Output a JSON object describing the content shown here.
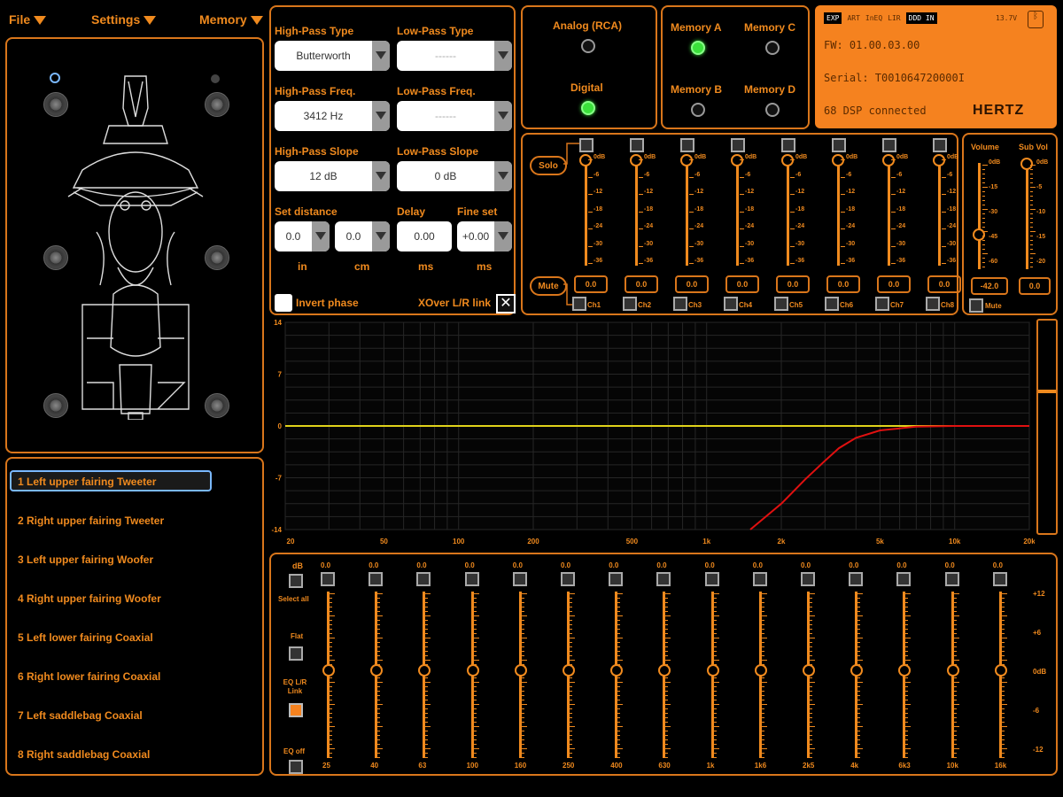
{
  "menu": {
    "file": "File",
    "settings": "Settings",
    "memory": "Memory"
  },
  "channels": [
    "1  Left upper fairing Tweeter",
    "2  Right upper fairing Tweeter",
    "3  Left upper fairing Woofer",
    "4  Right upper fairing Woofer",
    "5  Left lower fairing Coaxial",
    "6  Right lower fairing Coaxial",
    "7  Left saddlebag Coaxial",
    "8  Right saddlebag Coaxial"
  ],
  "selected_channel_index": 0,
  "crossover": {
    "hp_type_label": "High-Pass Type",
    "hp_type_value": "Butterworth",
    "lp_type_label": "Low-Pass Type",
    "lp_type_value": "------",
    "hp_freq_label": "High-Pass Freq.",
    "hp_freq_value": "3412 Hz",
    "lp_freq_label": "Low-Pass Freq.",
    "lp_freq_value": "------",
    "hp_slope_label": "High-Pass Slope",
    "hp_slope_value": "12 dB",
    "lp_slope_label": "Low-Pass Slope",
    "lp_slope_value": "0 dB",
    "set_distance_label": "Set distance",
    "distance_in": "0.0",
    "distance_cm": "0.0",
    "delay_label": "Delay",
    "delay_value": "0.00",
    "fine_set_label": "Fine set",
    "fine_set_value": "+0.00",
    "unit_in": "in",
    "unit_cm": "cm",
    "unit_ms1": "ms",
    "unit_ms2": "ms",
    "invert_phase_label": "Invert phase",
    "xover_link_label": "XOver L/R link"
  },
  "input": {
    "analog": "Analog (RCA)",
    "digital": "Digital",
    "active": "digital"
  },
  "memory": {
    "a": "Memory A",
    "b": "Memory B",
    "c": "Memory C",
    "d": "Memory D",
    "active": "a"
  },
  "device": {
    "tags": [
      "EXP",
      "ART",
      "InEQ",
      "LIR",
      "DDD IN"
    ],
    "voltage": "13.7V",
    "fw": "FW: 01.00.03.00",
    "serial": "Serial: T001064720000I",
    "status": "68 DSP connected",
    "brand": "HERTZ",
    "accent": "#f5821f"
  },
  "mixer": {
    "solo": "Solo",
    "mute": "Mute",
    "channel_labels": [
      "Ch1",
      "Ch2",
      "Ch3",
      "Ch4",
      "Ch5",
      "Ch6",
      "Ch7",
      "Ch8"
    ],
    "values": [
      "0.0",
      "0.0",
      "0.0",
      "0.0",
      "0.0",
      "0.0",
      "0.0",
      "0.0"
    ],
    "scale": [
      "0dB",
      "-6",
      "-12",
      "-18",
      "-24",
      "-30",
      "-36"
    ]
  },
  "master": {
    "volume_label": "Volume",
    "subvol_label": "Sub Vol",
    "volume_value": "-42.0",
    "subvol_value": "0.0",
    "volume_scale": [
      "0dB",
      "-15",
      "-30",
      "-45",
      "-60"
    ],
    "subvol_scale": [
      "0dB",
      "-5",
      "-10",
      "-15",
      "-20"
    ],
    "mute_label": "Mute"
  },
  "chart_data": {
    "type": "line",
    "title": "",
    "y_ticks": [
      "14",
      "7",
      "0",
      "-7",
      "-14"
    ],
    "ylim": [
      -14,
      14
    ],
    "x_ticks": [
      "20",
      "50",
      "100",
      "200",
      "500",
      "1k",
      "2k",
      "5k",
      "10k",
      "20k"
    ],
    "x_tick_values": [
      20,
      50,
      100,
      200,
      500,
      1000,
      2000,
      5000,
      10000,
      20000
    ],
    "series": [
      {
        "color": "#e0d21a",
        "x": [
          20,
          20000
        ],
        "y": [
          0,
          0
        ]
      },
      {
        "color": "#e01010",
        "x": [
          1500,
          2000,
          2500,
          3000,
          3412,
          4000,
          5000,
          7000,
          10000,
          20000
        ],
        "y": [
          -14,
          -10.5,
          -7.2,
          -4.7,
          -3.0,
          -1.6,
          -0.6,
          -0.1,
          0,
          0
        ]
      }
    ]
  },
  "eq": {
    "db_label": "dB",
    "select_all": "Select all",
    "flat": "Flat",
    "eq_lr_link": "EQ L/R Link",
    "eq_off": "EQ off",
    "bands": [
      "25",
      "40",
      "63",
      "100",
      "160",
      "250",
      "400",
      "630",
      "1k",
      "1k6",
      "2k5",
      "4k",
      "6k3",
      "10k",
      "16k"
    ],
    "values": [
      "0.0",
      "0.0",
      "0.0",
      "0.0",
      "0.0",
      "0.0",
      "0.0",
      "0.0",
      "0.0",
      "0.0",
      "0.0",
      "0.0",
      "0.0",
      "0.0",
      "0.0"
    ],
    "scale": [
      "+12",
      "+6",
      "0dB",
      "-6",
      "-12"
    ]
  }
}
